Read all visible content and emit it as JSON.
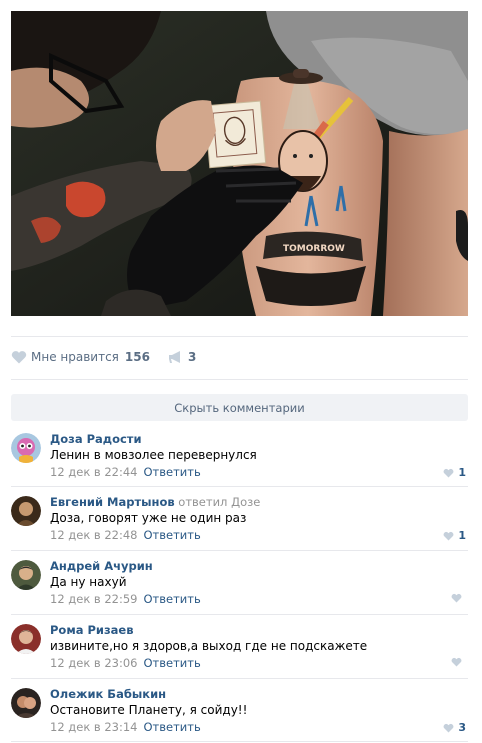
{
  "post": {
    "photo_alt": "tattoo-photo",
    "tattoo_text": "TOMORROW"
  },
  "actions": {
    "like_label": "Мне нравится",
    "like_count": "156",
    "share_count": "3"
  },
  "hide_comments_label": "Скрыть комментарии",
  "reply_label": "Ответить",
  "comments": [
    {
      "author": "Доза Радости",
      "replied": "",
      "replied_to": "",
      "text": "Ленин в мовзолее перевернулся",
      "date": "12 дек в 22:44",
      "likes": "1"
    },
    {
      "author": "Евгений Мартынов",
      "replied": "ответил",
      "replied_to": "Дозе",
      "text": "Доза, говорят уже не один раз",
      "date": "12 дек в 22:48",
      "likes": "1"
    },
    {
      "author": "Андрей Ачурин",
      "replied": "",
      "replied_to": "",
      "text": "Да ну нахуй",
      "date": "12 дек в 22:59",
      "likes": ""
    },
    {
      "author": "Рома Ризаев",
      "replied": "",
      "replied_to": "",
      "text": "извините,но я здоров,а выход где не подскажете",
      "date": "12 дек в 23:06",
      "likes": ""
    },
    {
      "author": "Олежик Бабыкин",
      "replied": "",
      "replied_to": "",
      "text": "Остановите Планету, я сойду!!",
      "date": "12 дек в 23:14",
      "likes": "3"
    }
  ],
  "colors": {
    "link": "#2a5885",
    "muted": "#939393",
    "action": "#5b6e84",
    "bar_bg": "#f0f2f5"
  }
}
